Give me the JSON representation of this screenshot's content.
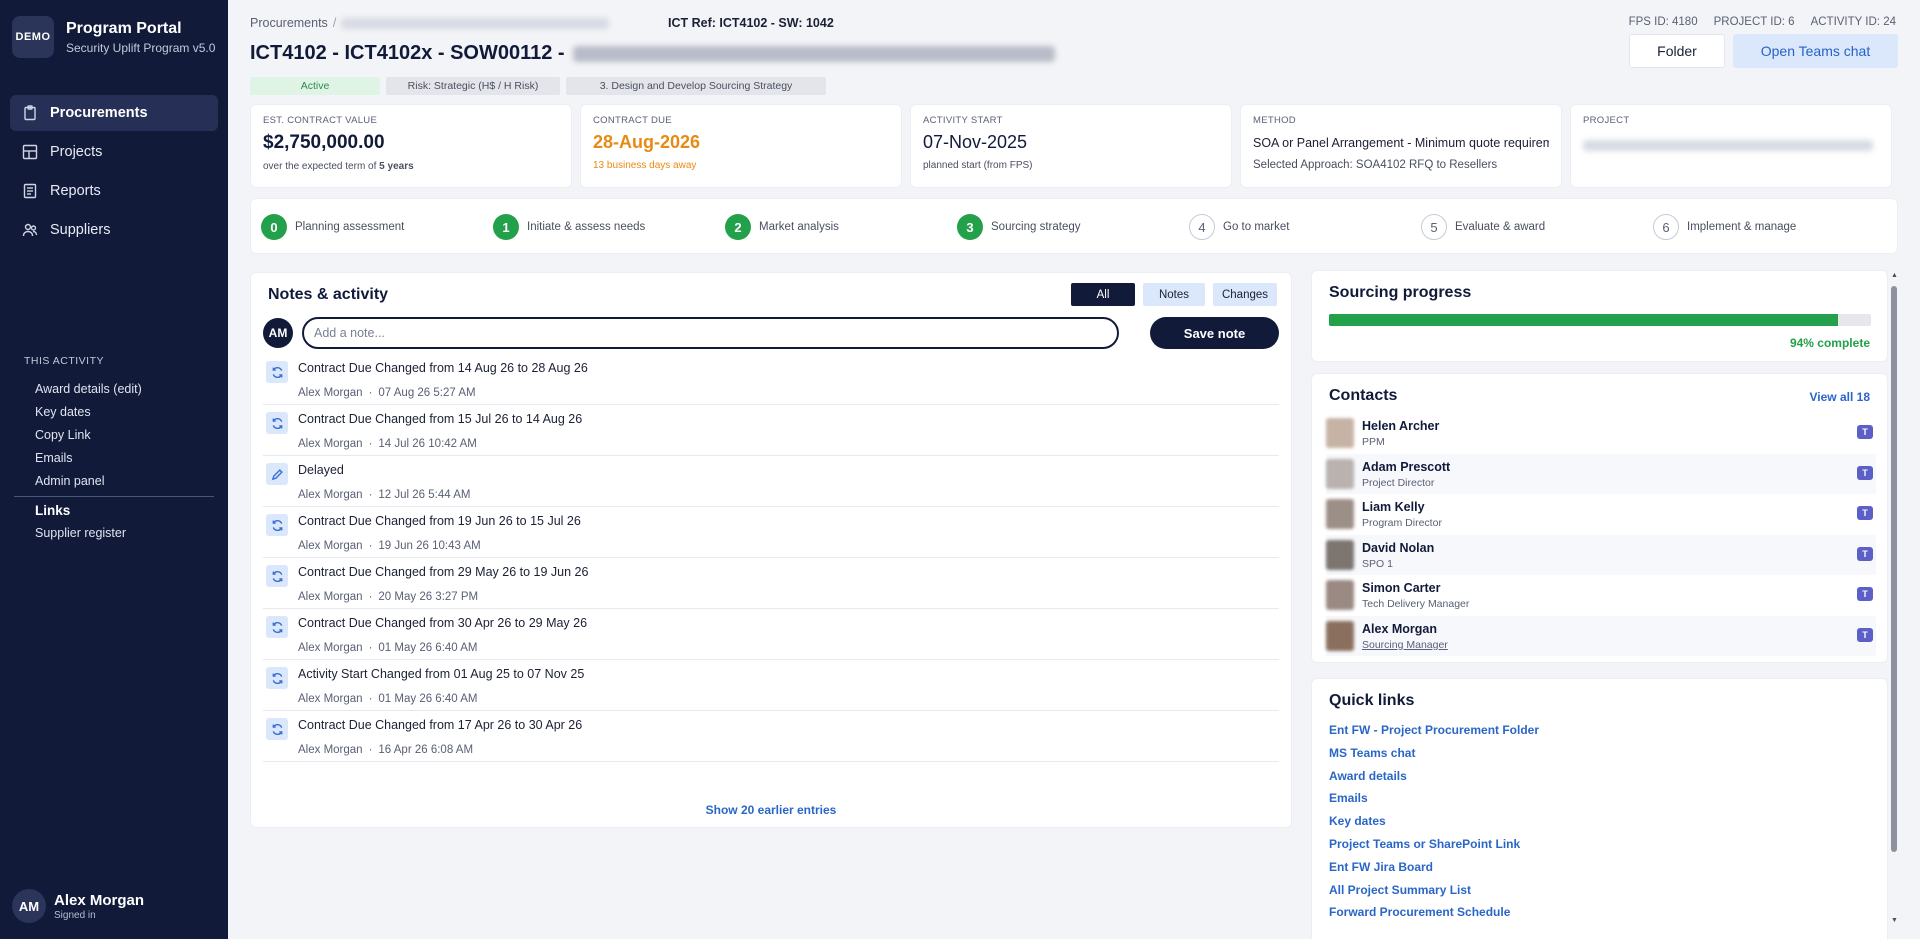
{
  "brand": {
    "badge": "DEMO",
    "title": "Program Portal",
    "subtitle": "Security Uplift Program v5.0"
  },
  "nav": [
    {
      "label": "Procurements",
      "icon": "clipboard-icon",
      "active": true
    },
    {
      "label": "Projects",
      "icon": "grid-icon",
      "active": false
    },
    {
      "label": "Reports",
      "icon": "document-icon",
      "active": false
    },
    {
      "label": "Suppliers",
      "icon": "users-icon",
      "active": false
    }
  ],
  "activity": {
    "heading": "THIS ACTIVITY",
    "items": [
      "Award details (edit)",
      "Key dates",
      "Copy Link",
      "Emails",
      "Admin panel"
    ],
    "links_label": "Links",
    "links_items": [
      "Supplier register"
    ]
  },
  "user": {
    "initials": "AM",
    "name": "Alex Morgan",
    "status": "Signed in"
  },
  "header": {
    "breadcrumb_root": "Procurements",
    "ict_ref": "ICT Ref: ICT4102 - SW: 1042",
    "fps_id": "FPS ID: 4180",
    "project_id": "PROJECT ID: 6",
    "activity_id": "ACTIVITY ID: 24",
    "title": "ICT4102 - ICT4102x - SOW00112 -",
    "folder_btn": "Folder",
    "teams_btn": "Open Teams chat"
  },
  "badges": {
    "status": "Active",
    "risk": "Risk: Strategic (H$ / H Risk)",
    "stage": "3. Design and Develop Sourcing Strategy"
  },
  "cards": {
    "contract_value": {
      "label": "EST. CONTRACT VALUE",
      "value": "$2,750,000.00",
      "note_prefix": "over the expected term of ",
      "note_bold": "5 years"
    },
    "contract_due": {
      "label": "CONTRACT DUE",
      "value": "28-Aug-2026",
      "note": "13 business days away"
    },
    "activity_start": {
      "label": "ACTIVITY START",
      "value": "07-Nov-2025",
      "note": "planned start (from FPS)"
    },
    "method": {
      "label": "METHOD",
      "value": "SOA or Panel Arrangement - Minimum quote requirem",
      "note": "Selected Approach: SOA4102 RFQ to Resellers"
    },
    "project": {
      "label": "PROJECT"
    }
  },
  "steps": [
    {
      "num": "0",
      "label": "Planning assessment",
      "done": true
    },
    {
      "num": "1",
      "label": "Initiate & assess needs",
      "done": true
    },
    {
      "num": "2",
      "label": "Market analysis",
      "done": true
    },
    {
      "num": "3",
      "label": "Sourcing strategy",
      "done": true
    },
    {
      "num": "4",
      "label": "Go to market",
      "done": false
    },
    {
      "num": "5",
      "label": "Evaluate & award",
      "done": false
    },
    {
      "num": "6",
      "label": "Implement & manage",
      "done": false
    }
  ],
  "notes": {
    "title": "Notes & activity",
    "filter_all": "All",
    "filter_notes": "Notes",
    "filter_changes": "Changes",
    "avatar": "AM",
    "placeholder": "Add a note...",
    "save_label": "Save note",
    "entries": [
      {
        "icon": "refresh-icon",
        "text": "Contract Due Changed from 14 Aug 26 to 28 Aug 26",
        "author": "Alex Morgan",
        "time": "07 Aug 26 5:27 AM"
      },
      {
        "icon": "refresh-icon",
        "text": "Contract Due Changed from 15 Jul 26 to 14 Aug 26",
        "author": "Alex Morgan",
        "time": "14 Jul 26 10:42 AM"
      },
      {
        "icon": "pencil-icon",
        "text": "Delayed",
        "author": "Alex Morgan",
        "time": "12 Jul 26 5:44 AM"
      },
      {
        "icon": "refresh-icon",
        "text": "Contract Due Changed from 19 Jun 26 to 15 Jul 26",
        "author": "Alex Morgan",
        "time": "19 Jun 26 10:43 AM"
      },
      {
        "icon": "refresh-icon",
        "text": "Contract Due Changed from 29 May 26 to 19 Jun 26",
        "author": "Alex Morgan",
        "time": "20 May 26 3:27 PM"
      },
      {
        "icon": "refresh-icon",
        "text": "Contract Due Changed from 30 Apr 26 to 29 May 26",
        "author": "Alex Morgan",
        "time": "01 May 26 6:40 AM"
      },
      {
        "icon": "refresh-icon",
        "text": "Activity Start Changed from 01 Aug 25 to 07 Nov 25",
        "author": "Alex Morgan",
        "time": "01 May 26 6:40 AM"
      },
      {
        "icon": "refresh-icon",
        "text": "Contract Due Changed from 17 Apr 26 to 30 Apr 26",
        "author": "Alex Morgan",
        "time": "16 Apr 26 6:08 AM"
      }
    ],
    "show_more": "Show 20 earlier entries"
  },
  "progress": {
    "title": "Sourcing progress",
    "percent": 94,
    "label": "94% complete"
  },
  "contacts": {
    "title": "Contacts",
    "view_all": "View all 18",
    "list": [
      {
        "name": "Helen Archer",
        "role": "PPM"
      },
      {
        "name": "Adam Prescott",
        "role": "Project Director"
      },
      {
        "name": "Liam Kelly",
        "role": "Program Director"
      },
      {
        "name": "David Nolan",
        "role": "SPO 1"
      },
      {
        "name": "Simon Carter",
        "role": "Tech Delivery Manager"
      },
      {
        "name": "Alex Morgan",
        "role": "Sourcing Manager"
      }
    ]
  },
  "quick_links": {
    "title": "Quick links",
    "items": [
      "Ent FW - Project Procurement Folder",
      "MS Teams chat",
      "Award details",
      "Emails",
      "Key dates",
      "Project Teams or SharePoint Link",
      "Ent FW Jira Board",
      "All Project Summary List",
      "Forward Procurement Schedule"
    ]
  },
  "colors": {
    "sidebar": "#121a3a",
    "accent": "#2a66c8",
    "success": "#22a04a",
    "warning": "#e88a14"
  }
}
